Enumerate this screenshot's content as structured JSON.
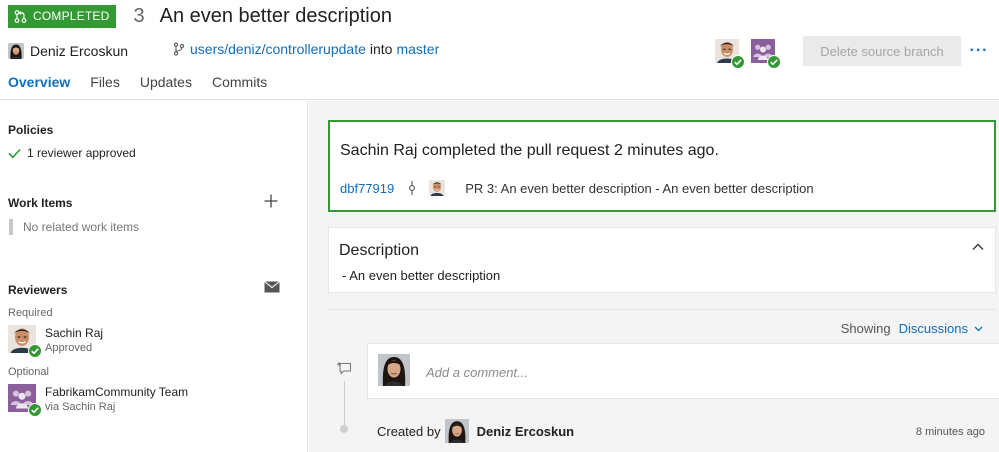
{
  "header": {
    "status": "COMPLETED",
    "pr_id": "3",
    "title": "An even better description",
    "author": "Deniz Ercoskun",
    "source_branch": "users/deniz/controllerupdate",
    "into_text": "into",
    "target_branch": "master",
    "delete_branch_label": "Delete source branch",
    "more_label": "···"
  },
  "tabs": [
    {
      "label": "Overview",
      "active": true
    },
    {
      "label": "Files",
      "active": false
    },
    {
      "label": "Updates",
      "active": false
    },
    {
      "label": "Commits",
      "active": false
    }
  ],
  "sidebar": {
    "policies_title": "Policies",
    "policy_status": "1 reviewer approved",
    "work_items_title": "Work Items",
    "no_work_items": "No related work items",
    "reviewers_title": "Reviewers",
    "required_label": "Required",
    "optional_label": "Optional",
    "reviewers": [
      {
        "name": "Sachin Raj",
        "sub": "Approved"
      },
      {
        "name": "FabrikamCommunity Team",
        "sub": "via Sachin Raj"
      }
    ]
  },
  "main": {
    "completed_message": "Sachin Raj completed the pull request 2 minutes ago.",
    "commit_id": "dbf77919",
    "commit_message": "PR 3: An even better description - An even better description",
    "description_title": "Description",
    "description_body": "- An even better description",
    "showing_label": "Showing",
    "showing_filter": "Discussions",
    "comment_placeholder": "Add a comment...",
    "created_by_label": "Created by",
    "created_by_name": "Deniz Ercoskun",
    "created_time": "8 minutes ago"
  },
  "colors": {
    "accent": "#106ebe",
    "success": "#339933",
    "team_avatar": "#8a5f9c"
  }
}
